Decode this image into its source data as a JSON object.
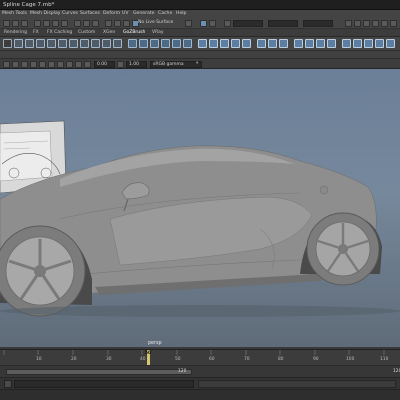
{
  "window": {
    "title": "Spline Cage 7.mb*"
  },
  "menus": [
    "Mesh Tools",
    "Mesh Display",
    "Curves",
    "Surfaces",
    "Deform",
    "UV",
    "Generate",
    "Cache",
    "Help"
  ],
  "status": {
    "live_surface": "No Live Surface"
  },
  "shelf_tabs": [
    "Rendering",
    "FX",
    "FX Caching",
    "Custom",
    "XGen",
    "GoZBrush",
    "VRay"
  ],
  "viewport_toolbar": {
    "field_a": "0.00",
    "field_b": "1.00",
    "color_space": "sRGB gamma"
  },
  "viewport": {
    "camera": "persp"
  },
  "timeline": {
    "ticks": [
      "10",
      "20",
      "30",
      "40",
      "50",
      "60",
      "70",
      "80",
      "90",
      "100",
      "110"
    ],
    "current_frame": "50"
  },
  "range": {
    "end_a": "120",
    "end_b": "120"
  },
  "colors": {
    "accent": "#6c8fb3",
    "sky_top": "#6b7f98",
    "ground": "#5f6b78",
    "car_body": "#8e8e8e",
    "playhead": "#d4c66a"
  }
}
